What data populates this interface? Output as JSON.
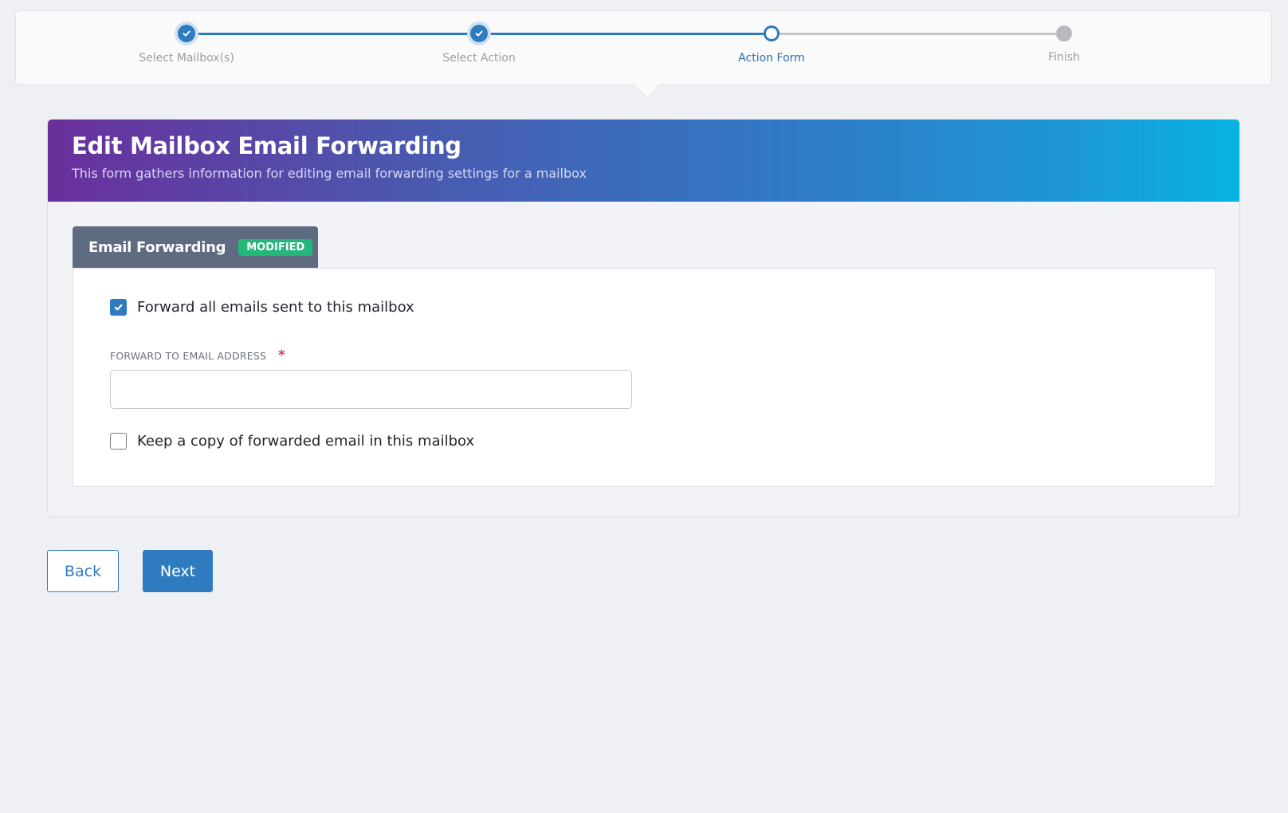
{
  "wizard": {
    "steps": [
      {
        "label": "Select Mailbox(s)",
        "state": "done"
      },
      {
        "label": "Select Action",
        "state": "done"
      },
      {
        "label": "Action Form",
        "state": "current"
      },
      {
        "label": "Finish",
        "state": "todo"
      }
    ]
  },
  "form": {
    "title": "Edit Mailbox Email Forwarding",
    "subtitle": "This form gathers information for editing email forwarding settings for a mailbox",
    "tab": {
      "label": "Email Forwarding",
      "badge": "MODIFIED"
    },
    "forward_all": {
      "label": "Forward all emails sent to this mailbox",
      "checked": true
    },
    "forward_address": {
      "label": "FORWARD TO EMAIL ADDRESS",
      "required_marker": "*",
      "value": ""
    },
    "keep_copy": {
      "label": "Keep a copy of forwarded email in this mailbox",
      "checked": false
    }
  },
  "actions": {
    "back_label": "Back",
    "next_label": "Next"
  },
  "colors": {
    "accent": "#2f7bbf",
    "badge": "#23b77a",
    "tab": "#5f6b81",
    "required": "#e0344a"
  },
  "icons": {
    "step_done": "check-icon",
    "checkbox_checked": "check-icon"
  }
}
